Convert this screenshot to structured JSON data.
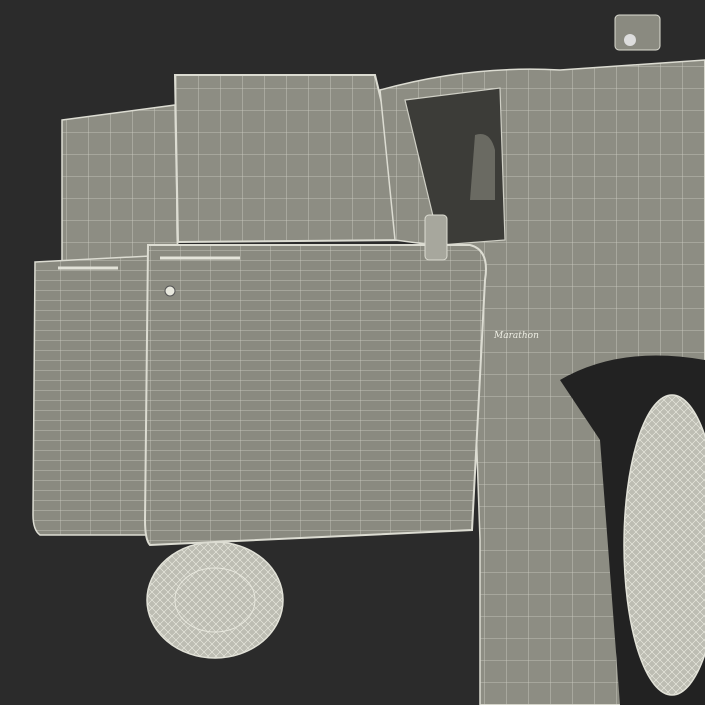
{
  "scene": {
    "background_color": "#2b2b2b",
    "body_color": "#8f8f85",
    "wire_color": "#d9d9cf",
    "tire_color": "#d0d0c6",
    "badge_text": "Marathon"
  }
}
